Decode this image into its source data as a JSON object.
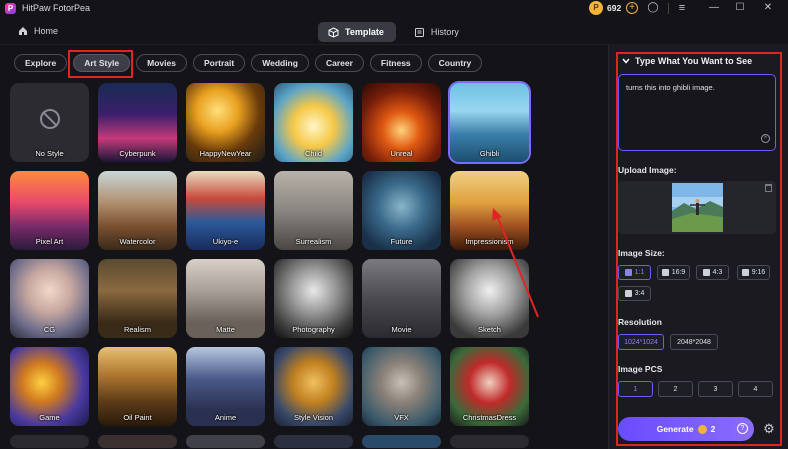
{
  "app": {
    "title": "HitPaw FotorPea",
    "logo": "P",
    "credits": "692"
  },
  "window": {
    "minimize": "—",
    "maximize": "☐",
    "close": "✕"
  },
  "nav": {
    "home": "Home",
    "tabs": [
      {
        "label": "Template",
        "icon": "cube-icon"
      },
      {
        "label": "History",
        "icon": "history-icon"
      }
    ]
  },
  "categories": [
    "Explore",
    "Art Style",
    "Movies",
    "Portrait",
    "Wedding",
    "Career",
    "Fitness",
    "Country"
  ],
  "active_category": "Art Style",
  "styles": [
    "No Style",
    "Cyberpunk",
    "HappyNewYear",
    "Child",
    "Unreal",
    "Ghibli",
    "Pixel Art",
    "Watercolor",
    "Ukiyo-e",
    "Surrealism",
    "Future",
    "Impressionism",
    "CG",
    "Realism",
    "Matte",
    "Photography",
    "Movie",
    "Sketch",
    "Game",
    "Oil Paint",
    "Anime",
    "Style Vision",
    "VFX",
    "ChristmasDress"
  ],
  "selected_style": "Ghibli",
  "panel": {
    "heading": "Type What You Want to See",
    "prompt": "turns this into ghibli image.",
    "upload_title": "Upload Image:",
    "size_title": "Image Size:",
    "sizes": [
      "1:1",
      "16:9",
      "4:3",
      "9:16",
      "3:4"
    ],
    "selected_size": "1:1",
    "resolution_title": "Resolution",
    "resolutions": [
      "1024*1024",
      "2048*2048"
    ],
    "selected_resolution": "1024*1024",
    "pcs_title": "Image PCS",
    "pcs": [
      "1",
      "2",
      "3",
      "4"
    ],
    "selected_pcs": "1",
    "generate": "Generate",
    "generate_cost": "2"
  },
  "colors": {
    "accent": "#6a5cff",
    "highlight": "#e02424",
    "coin": "#f2b33d"
  }
}
